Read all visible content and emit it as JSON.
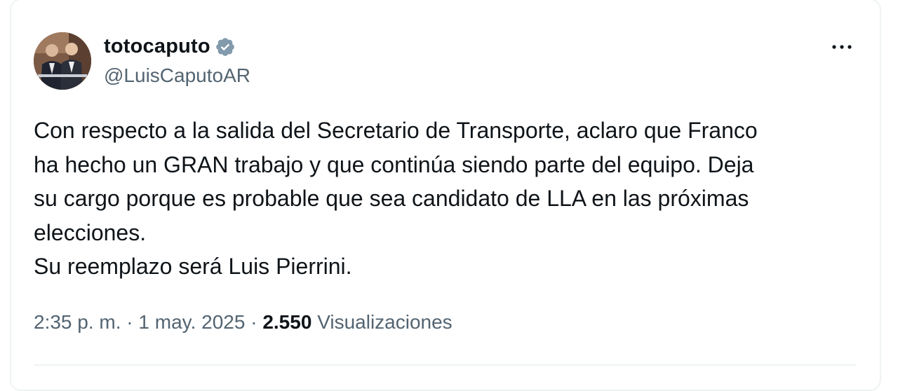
{
  "tweet": {
    "author": {
      "name": "totocaputo",
      "handle": "@LuisCaputoAR",
      "verified": true,
      "avatar_icon": "profile-photo"
    },
    "text": "Con respecto a la salida del Secretario de Transporte, aclaro que Franco\nha hecho un GRAN trabajo y que continúa siendo parte del equipo. Deja\nsu cargo porque es probable que sea candidato de LLA en las próximas\nelecciones.\nSu reemplazo será Luis Pierrini.",
    "time": "2:35 p. m.",
    "date": "1 may. 2025",
    "separator": "·",
    "views_count": "2.550",
    "views_label": "Visualizaciones"
  },
  "colors": {
    "text_primary": "#0f1419",
    "text_secondary": "#536471",
    "verified_badge": "#829aab",
    "border": "#eff3f4"
  },
  "icons": {
    "more": "more-horizontal-icon",
    "verified": "verified-badge-icon"
  }
}
